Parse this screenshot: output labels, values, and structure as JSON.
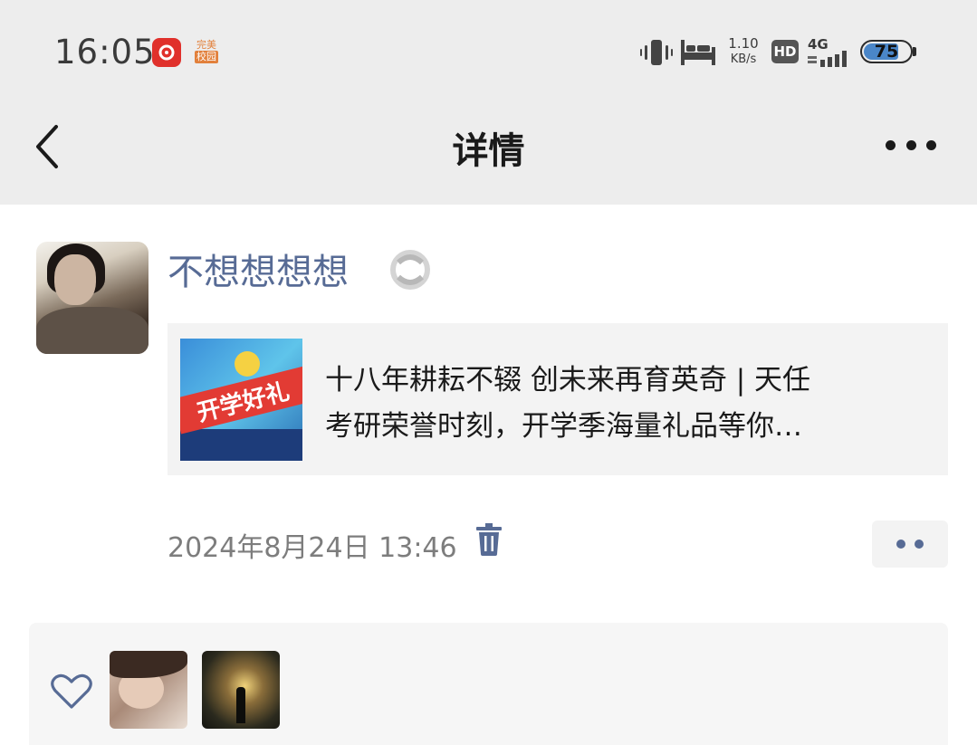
{
  "status_bar": {
    "time": "16:05",
    "app_badge_line1": "完美",
    "app_badge_line2": "校园",
    "net_speed_value": "1.10",
    "net_speed_unit": "KB/s",
    "hd_label": "HD",
    "network_type": "4G",
    "battery_level": "75"
  },
  "nav": {
    "title": "详情"
  },
  "post": {
    "username": "不想想想想",
    "link_card": {
      "thumbnail_text": "开学好礼",
      "title": "十八年耕耘不辍 创未来再育英奇 | 天任",
      "title_line2": "考研荣誉时刻，开学季海量礼品等你…"
    },
    "timestamp": "2024年8月24日 13:46"
  },
  "icons": {
    "back": "chevron-left-icon",
    "more": "more-dots-icon",
    "delete": "trash-icon",
    "like": "heart-icon"
  },
  "colors": {
    "link_blue": "#576b95",
    "header_bg": "#ededed",
    "card_bg": "#f3f3f3"
  }
}
